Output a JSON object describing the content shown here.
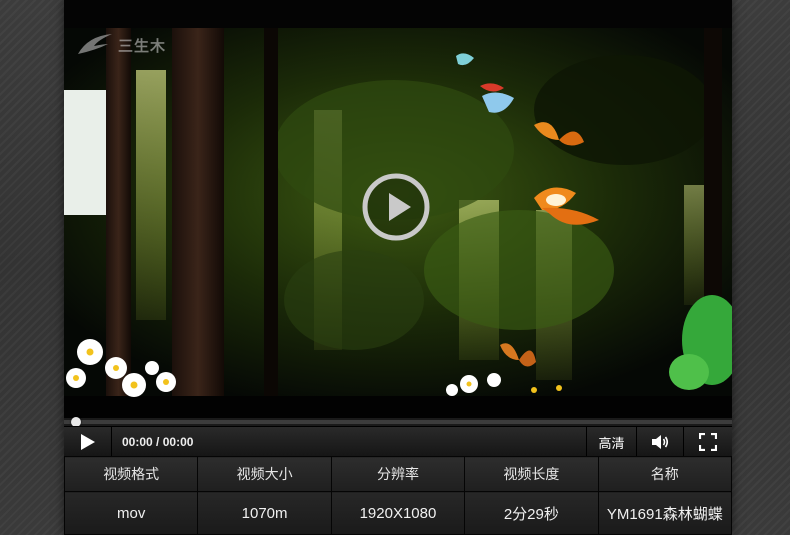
{
  "logo": {
    "text": "三生木"
  },
  "player": {
    "current_time": "00:00",
    "duration": "00:00",
    "time_separator": " / ",
    "progress": 0.0,
    "hd_label": "高清",
    "icons": {
      "play": "play-icon",
      "overlay_play": "play-circle-icon",
      "volume": "volume-icon",
      "fullscreen": "fullscreen-icon"
    }
  },
  "info_table": {
    "headers": [
      "视频格式",
      "视频大小",
      "分辨率",
      "视频长度",
      "名称"
    ],
    "values": [
      "mov",
      "1070m",
      "1920X1080",
      "2分29秒",
      "YM1691森林蝴蝶"
    ]
  },
  "colors": {
    "background": "#3a3a3a",
    "player": "#0a0a0a",
    "text": "#f0f0f0"
  }
}
